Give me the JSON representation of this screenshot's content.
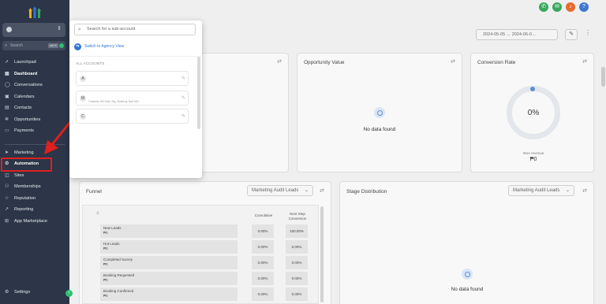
{
  "sidebar": {
    "search_label": "Search",
    "search_shortcut": "ctrl K",
    "items": [
      {
        "label": "Launchpad",
        "icon": "launchpad-icon"
      },
      {
        "label": "Dashboard",
        "icon": "dashboard-icon"
      },
      {
        "label": "Conversations",
        "icon": "chat-icon"
      },
      {
        "label": "Calendars",
        "icon": "calendar-icon"
      },
      {
        "label": "Contacts",
        "icon": "contacts-icon"
      },
      {
        "label": "Opportunities",
        "icon": "opportunities-icon"
      },
      {
        "label": "Payments",
        "icon": "payments-icon"
      },
      {
        "label": "Marketing",
        "icon": "send-icon"
      },
      {
        "label": "Automation",
        "icon": "automation-icon"
      },
      {
        "label": "Sites",
        "icon": "sites-icon"
      },
      {
        "label": "Memberships",
        "icon": "memberships-icon"
      },
      {
        "label": "Reputation",
        "icon": "star-icon"
      },
      {
        "label": "Reporting",
        "icon": "chart-icon"
      },
      {
        "label": "App Marketplace",
        "icon": "grid-icon"
      }
    ],
    "settings_label": "Settings"
  },
  "dropdown": {
    "search_placeholder": "Search for a sub-account",
    "switch_label": "Switch to Agency View",
    "section_label": "ALL ACCOUNTS",
    "accounts": [
      {
        "initial": "A",
        "name": "",
        "subtitle": ""
      },
      {
        "initial": "M",
        "name": "",
        "subtitle": "Outskirts Hill East, Big, Building, Bad Mill"
      },
      {
        "initial": "C",
        "name": "",
        "subtitle": ""
      }
    ]
  },
  "header": {
    "date_range": "2024-05-05  →  2024-06-0…"
  },
  "cards": {
    "opportunity_value": {
      "title": "Opportunity Value",
      "empty_text": "No data found"
    },
    "conversion_rate": {
      "title": "Conversion Rate",
      "percent": "0%",
      "revenue_label": "Won revenue",
      "revenue_value": "₱0"
    }
  },
  "funnel": {
    "title": "Funnel",
    "select_value": "Marketing Audit Leads",
    "col_sort": "△",
    "col_cumulative": "Cumulative",
    "col_next_step": "Next Step Conversion",
    "rows": [
      {
        "stage": "New Leads",
        "value": "₱0",
        "cumulative": "0.00%",
        "next": "100.00%"
      },
      {
        "stage": "Hot Leads",
        "value": "₱0",
        "cumulative": "0.00%",
        "next": "0.00%"
      },
      {
        "stage": "Completed Survey",
        "value": "₱0",
        "cumulative": "0.00%",
        "next": "0.00%"
      },
      {
        "stage": "Booking Requested",
        "value": "₱0",
        "cumulative": "0.00%",
        "next": "0.00%"
      },
      {
        "stage": "Booking Confirmed",
        "value": "₱0",
        "cumulative": "0.00%",
        "next": "0.00%"
      }
    ]
  },
  "stage_distribution": {
    "title": "Stage Distribution",
    "select_value": "Marketing Audit Leads",
    "empty_text": "No data found"
  },
  "colors": {
    "sidebar_bg": "#2c3648",
    "highlight_red": "#e01f1f",
    "accent_blue": "#2f76d6",
    "green": "#2fbf71"
  }
}
